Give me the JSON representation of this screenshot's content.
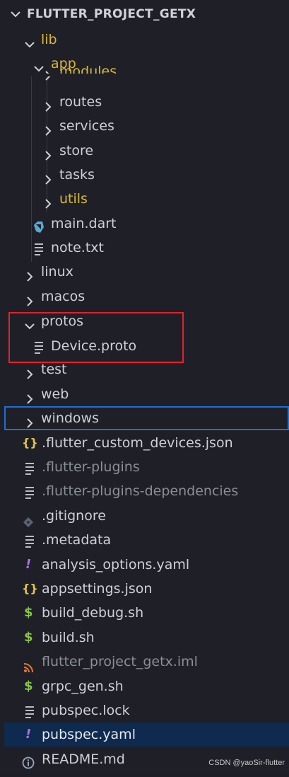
{
  "explorer": {
    "project_title": "FLUTTER_PROJECT_GETX",
    "items": [
      {
        "label": "lib",
        "icon": "chevron-down-icon"
      },
      {
        "label": "app",
        "icon": "chevron-down-icon"
      },
      {
        "label": "modules",
        "icon": "chevron-right-icon"
      },
      {
        "label": "routes",
        "icon": "chevron-right-icon"
      },
      {
        "label": "services",
        "icon": "chevron-right-icon"
      },
      {
        "label": "store",
        "icon": "chevron-right-icon"
      },
      {
        "label": "tasks",
        "icon": "chevron-right-icon"
      },
      {
        "label": "utils",
        "icon": "chevron-right-icon"
      },
      {
        "label": "main.dart",
        "icon": "dart-icon"
      },
      {
        "label": "note.txt",
        "icon": "text-file-icon"
      },
      {
        "label": "linux",
        "icon": "chevron-right-icon"
      },
      {
        "label": "macos",
        "icon": "chevron-right-icon"
      },
      {
        "label": "protos",
        "icon": "chevron-down-icon"
      },
      {
        "label": "Device.proto",
        "icon": "text-file-icon"
      },
      {
        "label": "test",
        "icon": "chevron-right-icon"
      },
      {
        "label": "web",
        "icon": "chevron-right-icon"
      },
      {
        "label": "windows",
        "icon": "chevron-right-icon"
      },
      {
        "label": ".flutter_custom_devices.json",
        "icon": "json-icon",
        "glyph": "{}"
      },
      {
        "label": ".flutter-plugins",
        "icon": "text-file-icon"
      },
      {
        "label": ".flutter-plugins-dependencies",
        "icon": "text-file-icon"
      },
      {
        "label": ".gitignore",
        "icon": "git-icon"
      },
      {
        "label": ".metadata",
        "icon": "text-file-icon"
      },
      {
        "label": "analysis_options.yaml",
        "icon": "yaml-icon",
        "glyph": "!"
      },
      {
        "label": "appsettings.json",
        "icon": "json-icon",
        "glyph": "{}"
      },
      {
        "label": "build_debug.sh",
        "icon": "shell-icon",
        "glyph": "$"
      },
      {
        "label": "build.sh",
        "icon": "shell-icon",
        "glyph": "$"
      },
      {
        "label": "flutter_project_getx.iml",
        "icon": "rss-icon"
      },
      {
        "label": "grpc_gen.sh",
        "icon": "shell-icon",
        "glyph": "$"
      },
      {
        "label": "pubspec.lock",
        "icon": "text-file-icon"
      },
      {
        "label": "pubspec.yaml",
        "icon": "yaml-icon",
        "glyph": "!"
      },
      {
        "label": "README.md",
        "icon": "info-icon"
      }
    ]
  },
  "watermark": "CSDN @yaoSir-flutter",
  "colors": {
    "background": "#1f2027",
    "text": "#cdd0d6",
    "folder_yellow": "#d8b73a",
    "muted": "#8b8e95",
    "json": "#e5c549",
    "yaml": "#a974e0",
    "shell": "#89c644",
    "rss": "#e37933",
    "git": "#5c6173",
    "info": "#9aa7bb",
    "dart": "#58a9d6",
    "highlight_box": "#e0232b",
    "focus_outline": "#1f6fd0",
    "active_selection": "#0e2a4f"
  }
}
